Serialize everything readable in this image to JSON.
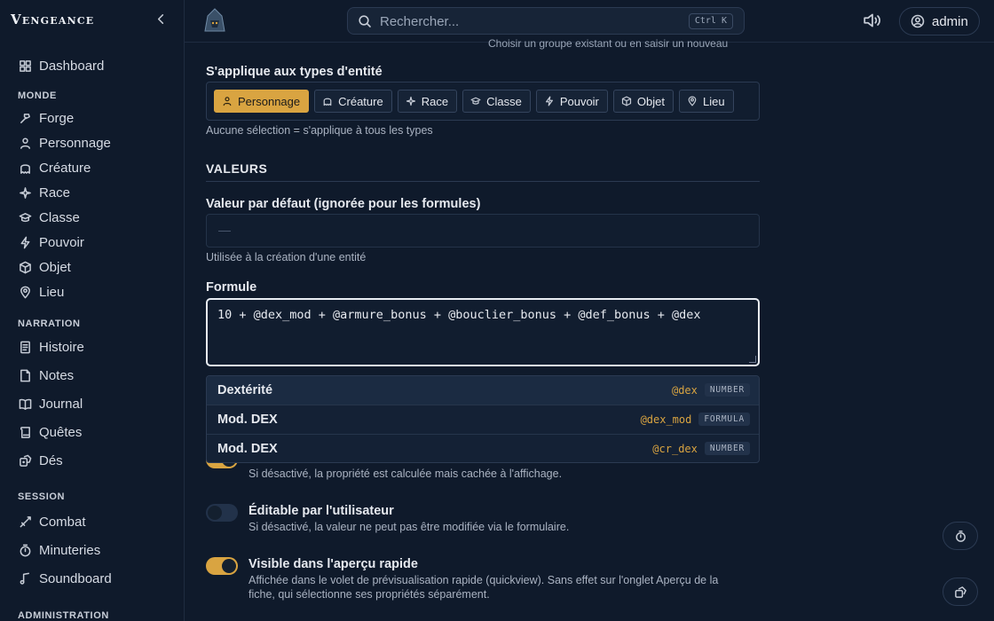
{
  "brand": "Vengeance",
  "sidebar": {
    "dashboard": "Dashboard",
    "sections": {
      "monde": "MONDE",
      "narration": "NARRATION",
      "session": "SESSION",
      "administration": "ADMINISTRATION"
    },
    "monde_items": [
      {
        "label": "Forge",
        "icon": "hammer-icon"
      },
      {
        "label": "Personnage",
        "icon": "user-icon"
      },
      {
        "label": "Créature",
        "icon": "ghost-icon"
      },
      {
        "label": "Race",
        "icon": "sparkle-icon"
      },
      {
        "label": "Classe",
        "icon": "graduation-cap-icon"
      },
      {
        "label": "Pouvoir",
        "icon": "lightning-icon"
      },
      {
        "label": "Objet",
        "icon": "box-icon"
      },
      {
        "label": "Lieu",
        "icon": "map-pin-icon"
      }
    ],
    "narration_items": [
      {
        "label": "Histoire",
        "icon": "document-icon"
      },
      {
        "label": "Notes",
        "icon": "note-icon"
      },
      {
        "label": "Journal",
        "icon": "book-icon"
      },
      {
        "label": "Quêtes",
        "icon": "scroll-icon"
      },
      {
        "label": "Dés",
        "icon": "dice-icon"
      }
    ],
    "session_items": [
      {
        "label": "Combat",
        "icon": "sword-icon"
      },
      {
        "label": "Minuteries",
        "icon": "timer-icon"
      },
      {
        "label": "Soundboard",
        "icon": "music-note-icon"
      }
    ]
  },
  "topbar": {
    "search_placeholder": "Rechercher...",
    "search_shortcut": "Ctrl K",
    "user": "admin"
  },
  "form": {
    "group_hint": "Choisir un groupe existant ou en saisir un nouveau",
    "entity_types_label": "S'applique aux types d'entité",
    "entity_types": [
      {
        "label": "Personnage",
        "icon": "user-icon",
        "selected": true
      },
      {
        "label": "Créature",
        "icon": "ghost-icon",
        "selected": false
      },
      {
        "label": "Race",
        "icon": "sparkle-icon",
        "selected": false
      },
      {
        "label": "Classe",
        "icon": "graduation-cap-icon",
        "selected": false
      },
      {
        "label": "Pouvoir",
        "icon": "lightning-icon",
        "selected": false
      },
      {
        "label": "Objet",
        "icon": "box-icon",
        "selected": false
      },
      {
        "label": "Lieu",
        "icon": "map-pin-icon",
        "selected": false
      }
    ],
    "entity_types_hint": "Aucune sélection = s'applique à tous les types",
    "section_values": "VALEURS",
    "default_value_label": "Valeur par défaut (ignorée pour les formules)",
    "default_value_placeholder": "—",
    "default_value_hint": "Utilisée à la création d'une entité",
    "formula_label": "Formule",
    "formula_value": "10 + @dex_mod + @armure_bonus + @bouclier_bonus + @def_bonus + @dex",
    "suggestions": [
      {
        "name": "Dextérité",
        "var": "@dex",
        "type": "NUMBER"
      },
      {
        "name": "Mod. DEX",
        "var": "@dex_mod",
        "type": "FORMULA"
      },
      {
        "name": "Mod. DEX",
        "var": "@cr_dex",
        "type": "NUMBER"
      }
    ],
    "toggles": [
      {
        "title": "",
        "desc": "Si désactivé, la propriété est calculée mais cachée à l'affichage.",
        "on": true
      },
      {
        "title": "Éditable par l'utilisateur",
        "desc": "Si désactivé, la valeur ne peut pas être modifiée via le formulaire.",
        "on": false
      },
      {
        "title": "Visible dans l'aperçu rapide",
        "desc": "Affichée dans le volet de prévisualisation rapide (quickview). Sans effet sur l'onglet Aperçu de la fiche, qui sélectionne ses propriétés séparément.",
        "on": true
      }
    ]
  },
  "colors": {
    "accent": "#d9a441",
    "background": "#0f1a2b",
    "panel": "#111d2f"
  }
}
